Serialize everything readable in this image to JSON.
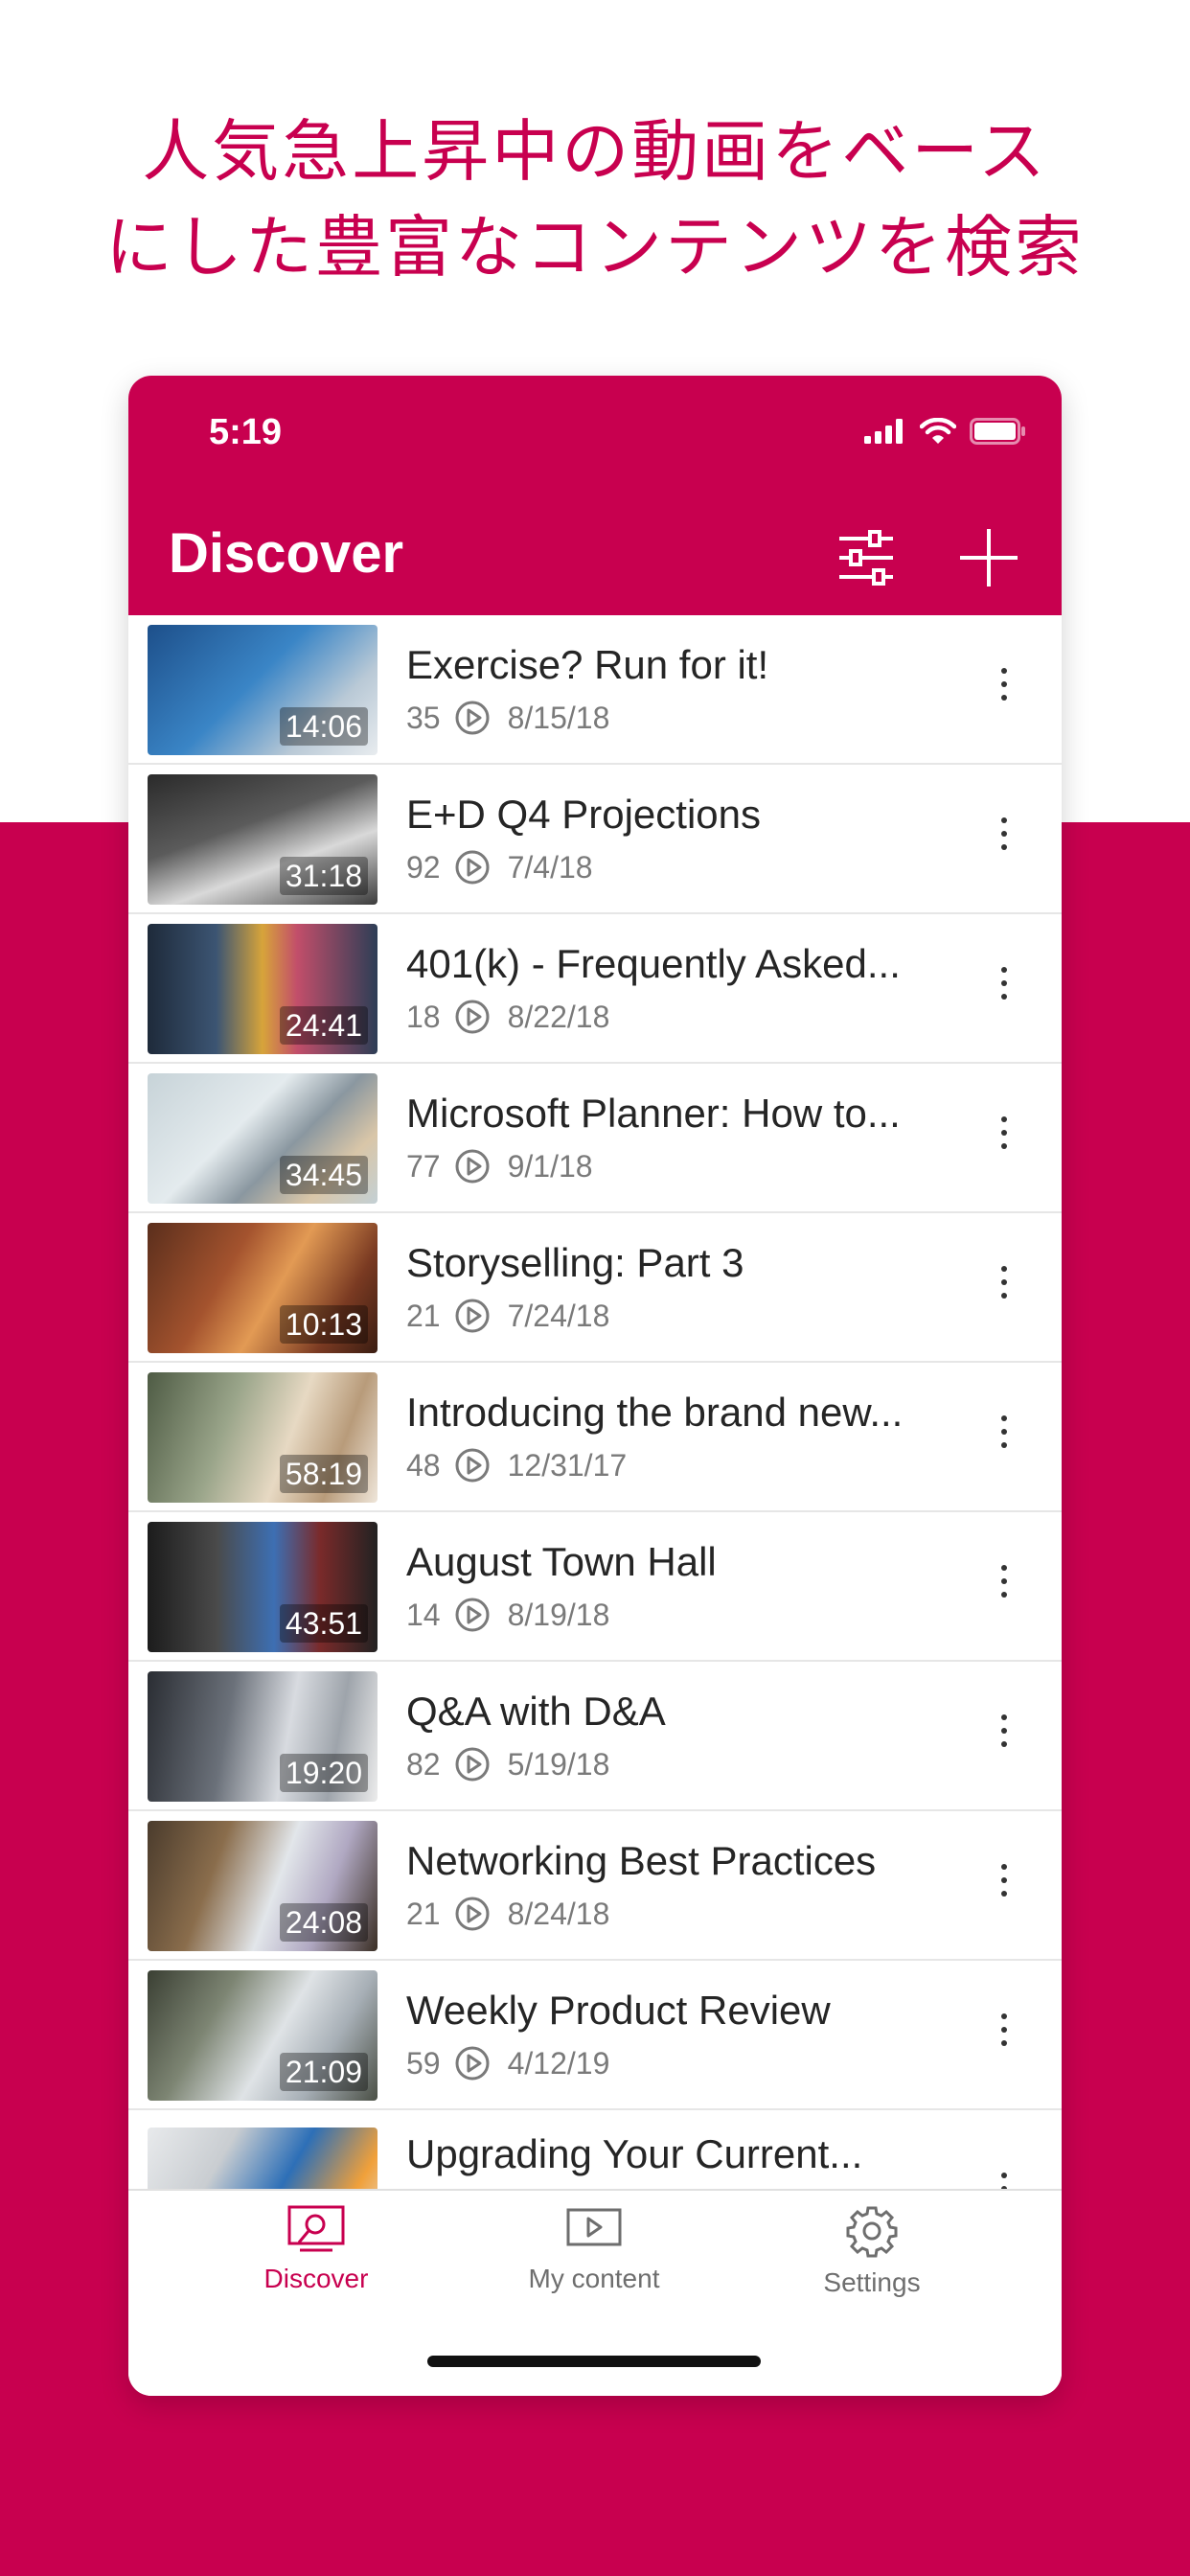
{
  "headline": {
    "line1": "人気急上昇中の動画をベース",
    "line2": "にした豊富なコンテンツを検索"
  },
  "status": {
    "time": "5:19"
  },
  "header": {
    "title": "Discover"
  },
  "colors": {
    "accent": "#c8004f",
    "text": "#252525",
    "muted": "#7a7a7a"
  },
  "videos": [
    {
      "title": "Exercise? Run for it!",
      "views": "35",
      "date": "8/15/18",
      "duration": "14:06"
    },
    {
      "title": "E+D Q4 Projections",
      "views": "92",
      "date": "7/4/18",
      "duration": "31:18"
    },
    {
      "title": "401(k) - Frequently Asked...",
      "views": "18",
      "date": "8/22/18",
      "duration": "24:41"
    },
    {
      "title": "Microsoft Planner: How to...",
      "views": "77",
      "date": "9/1/18",
      "duration": "34:45"
    },
    {
      "title": "Storyselling: Part 3",
      "views": "21",
      "date": "7/24/18",
      "duration": "10:13"
    },
    {
      "title": "Introducing the brand new...",
      "views": "48",
      "date": "12/31/17",
      "duration": "58:19"
    },
    {
      "title": "August Town Hall",
      "views": "14",
      "date": "8/19/18",
      "duration": "43:51"
    },
    {
      "title": "Q&A with D&A",
      "views": "82",
      "date": "5/19/18",
      "duration": "19:20"
    },
    {
      "title": "Networking Best Practices",
      "views": "21",
      "date": "8/24/18",
      "duration": "24:08"
    },
    {
      "title": "Weekly Product Review",
      "views": "59",
      "date": "4/12/19",
      "duration": "21:09"
    },
    {
      "title": "Upgrading Your Current...",
      "views": "",
      "date": "",
      "duration": ""
    }
  ],
  "tabs": [
    {
      "label": "Discover",
      "icon": "discover-icon",
      "active": true
    },
    {
      "label": "My content",
      "icon": "video-icon",
      "active": false
    },
    {
      "label": "Settings",
      "icon": "gear-icon",
      "active": false
    }
  ]
}
